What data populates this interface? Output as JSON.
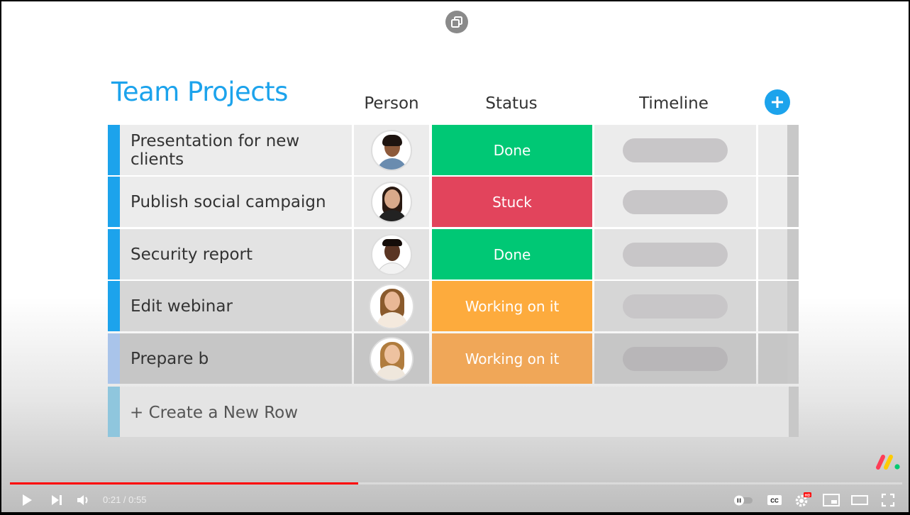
{
  "board": {
    "title": "Team Projects",
    "columns": {
      "person": "Person",
      "status": "Status",
      "timeline": "Timeline"
    }
  },
  "rows": [
    {
      "name": "Presentation for new clients",
      "status": "Done",
      "status_color": "#00c875",
      "stripe_color": "#1ca3ec"
    },
    {
      "name": "Publish social campaign",
      "status": "Stuck",
      "status_color": "#e2445c",
      "stripe_color": "#1ca3ec"
    },
    {
      "name": "Security report",
      "status": "Done",
      "status_color": "#00c875",
      "stripe_color": "#1ca3ec"
    },
    {
      "name": "Edit webinar",
      "status": "Working on it",
      "status_color": "#fdab3d",
      "stripe_color": "#1ca3ec"
    },
    {
      "name": "Prepare b",
      "status": "Working on it",
      "status_color": "#f0a758",
      "stripe_color": "#a9c4ea"
    }
  ],
  "new_row_label": "+ Create a New Row",
  "player": {
    "current_time": "0:21",
    "separator": " / ",
    "duration": "0:55",
    "progress_fraction": 0.39,
    "hd_badge": "HD"
  },
  "colors": {
    "accent": "#1ca3ec",
    "progress": "#ff0000"
  }
}
